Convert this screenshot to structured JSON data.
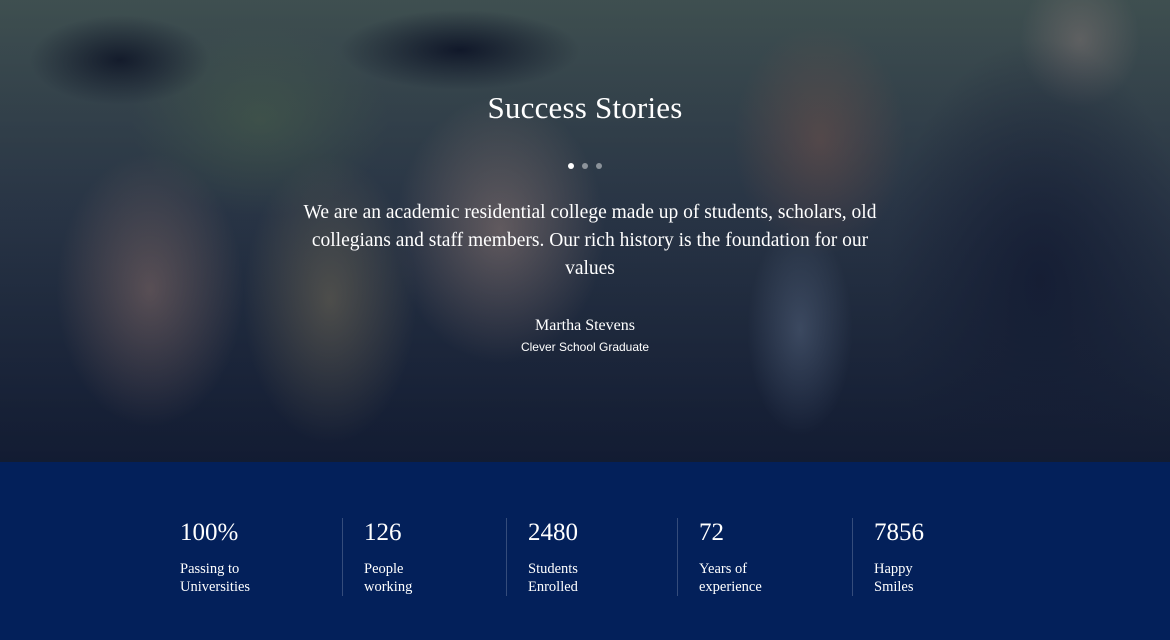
{
  "testimonials": {
    "title": "Success Stories",
    "slide_count": 3,
    "active_slide": 1,
    "quote": "We are an academic residential college made up of students, scholars, old collegians and staff members. Our rich history is the foundation for our values",
    "author_name": "Martha Stevens",
    "author_role": "Clever School Graduate"
  },
  "stats": [
    {
      "value": "100%",
      "label": "Passing to Universities"
    },
    {
      "value": "126",
      "label": "People working"
    },
    {
      "value": "2480",
      "label": "Students Enrolled"
    },
    {
      "value": "72",
      "label": "Years of experience"
    },
    {
      "value": "7856",
      "label": "Happy Smiles"
    }
  ],
  "colors": {
    "stats_background": "#03205a",
    "text": "#ffffff"
  }
}
